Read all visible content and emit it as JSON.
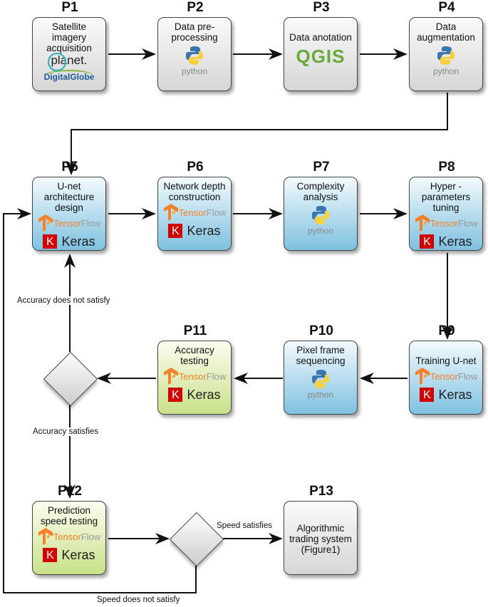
{
  "nodes": [
    {
      "id": "P1",
      "title": "Satellite imagery acquisition",
      "theme": "gray",
      "logos": [
        "planet",
        "digitalglobe"
      ]
    },
    {
      "id": "P2",
      "title": "Data pre-processing",
      "theme": "gray",
      "logos": [
        "python"
      ]
    },
    {
      "id": "P3",
      "title": "Data anotation",
      "theme": "gray",
      "logos": [
        "qgis"
      ]
    },
    {
      "id": "P4",
      "title": "Data augmentation",
      "theme": "gray",
      "logos": [
        "python"
      ]
    },
    {
      "id": "P5",
      "title": "U-net architecture design",
      "theme": "blue",
      "logos": [
        "tensorflow",
        "keras"
      ]
    },
    {
      "id": "P6",
      "title": "Network depth construction",
      "theme": "blue",
      "logos": [
        "tensorflow",
        "keras"
      ]
    },
    {
      "id": "P7",
      "title": "Complexity analysis",
      "theme": "blue",
      "logos": [
        "python"
      ]
    },
    {
      "id": "P8",
      "title": "Hyper - parameters tuning",
      "theme": "blue",
      "logos": [
        "tensorflow",
        "keras"
      ]
    },
    {
      "id": "P9",
      "title": "Training U-net",
      "theme": "blue",
      "logos": [
        "tensorflow",
        "keras"
      ]
    },
    {
      "id": "P10",
      "title": "Pixel frame sequencing",
      "theme": "blue",
      "logos": [
        "python"
      ]
    },
    {
      "id": "P11",
      "title": "Accuracy testing",
      "theme": "green",
      "logos": [
        "tensorflow",
        "keras"
      ]
    },
    {
      "id": "P12",
      "title": "Prediction speed testing",
      "theme": "green",
      "logos": [
        "tensorflow",
        "keras"
      ]
    },
    {
      "id": "P13",
      "title": "Algorithmic trading system (Figure1)",
      "theme": "gray",
      "logos": []
    }
  ],
  "logo_text": {
    "python": "python",
    "tensor": "Tensor",
    "flow": "Flow",
    "keras": "Keras",
    "keras_k": "K",
    "qgis": "QGIS",
    "planet": "planet.",
    "digitalglobe": "DigitalGlobe"
  },
  "edge_labels": {
    "acc_fail": "Accuracy does not satisfy",
    "acc_ok": "Accuracy satisfies",
    "speed_ok": "Speed satisfies",
    "speed_fail": "Speed does not satisfy"
  },
  "colors": {
    "gray": "#d6d6d6",
    "blue": "#7ec1e0",
    "green": "#c9e08a",
    "tensorflow": "#f5822a",
    "keras": "#d00000",
    "qgis": "#6aa83a"
  }
}
